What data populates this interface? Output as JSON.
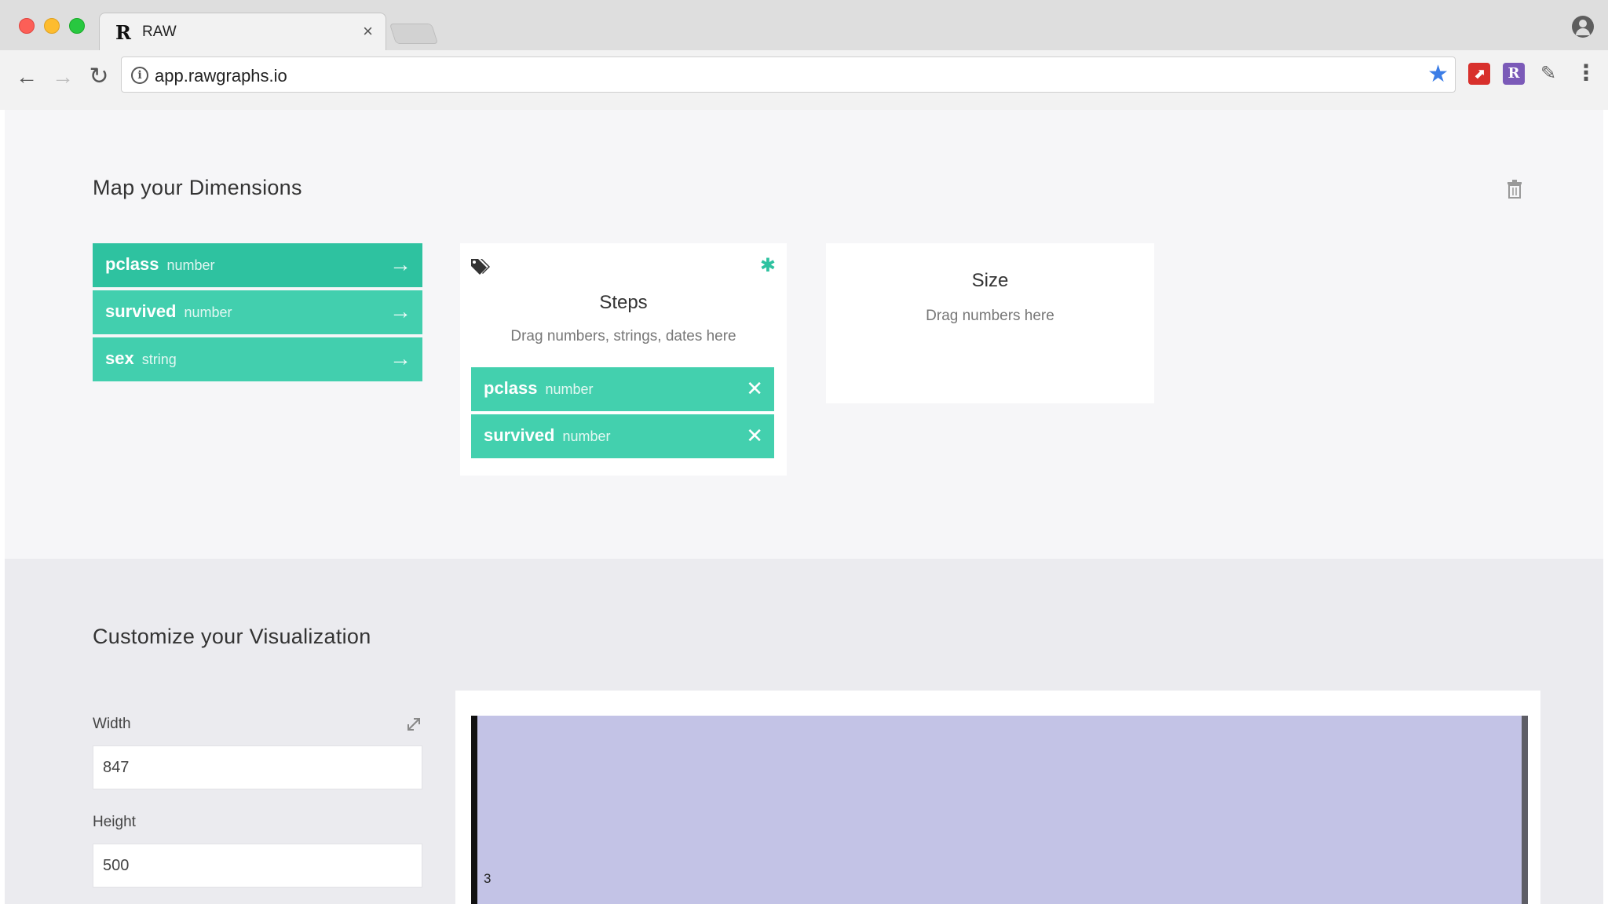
{
  "browser": {
    "tab_title": "RAW",
    "tab_favicon": "R",
    "tab_close": "×",
    "url": "app.rawgraphs.io",
    "icons": [
      "back-arrow-icon",
      "forward-arrow-icon",
      "reload-icon",
      "info-icon",
      "star-icon",
      "pdf-extension-icon",
      "r-extension-icon",
      "eyedropper-extension-icon",
      "kebab-menu-icon",
      "profile-icon"
    ]
  },
  "dimensions": {
    "title": "Map your Dimensions",
    "items": [
      {
        "name": "pclass",
        "type": "number"
      },
      {
        "name": "survived",
        "type": "number"
      },
      {
        "name": "sex",
        "type": "string"
      }
    ],
    "steps_card": {
      "title": "Steps",
      "hint": "Drag numbers, strings, dates here",
      "required_mark": "✱",
      "items": [
        {
          "name": "pclass",
          "type": "number"
        },
        {
          "name": "survived",
          "type": "number"
        }
      ]
    },
    "size_card": {
      "title": "Size",
      "hint": "Drag numbers here"
    }
  },
  "customize": {
    "title": "Customize your Visualization",
    "width_label": "Width",
    "width_value": "847",
    "height_label": "Height",
    "height_value": "500",
    "viz_label": "3"
  },
  "colors": {
    "accent": "#2ec2a0",
    "viz_fill": "#c3c3e6"
  }
}
